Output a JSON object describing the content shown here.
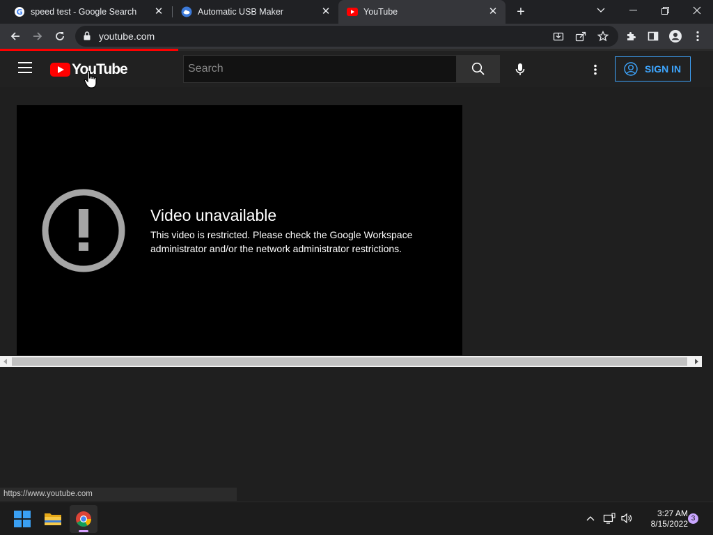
{
  "browser": {
    "tabs": [
      {
        "title": "speed test - Google Search",
        "favicon": "google-icon"
      },
      {
        "title": "Automatic USB Maker",
        "favicon": "cloud-icon"
      },
      {
        "title": "YouTube",
        "favicon": "youtube-icon",
        "active": true
      }
    ],
    "close_glyph": "✕",
    "new_tab_glyph": "+",
    "url": "youtube.com",
    "status_url": "https://www.youtube.com",
    "load_progress": 0.25
  },
  "youtube": {
    "logo_text": "YouTube",
    "search_placeholder": "Search",
    "sign_in": "SIGN IN",
    "error_title": "Video unavailable",
    "error_message": "This video is restricted. Please check the Google Workspace administrator and/or the network administrator restrictions."
  },
  "taskbar": {
    "time": "3:27 AM",
    "date": "8/15/2022",
    "notifications": "3"
  },
  "colors": {
    "accent_red": "#ff0000",
    "sign_in_blue": "#3ea6ff",
    "page_bg": "#1f1f1f"
  }
}
